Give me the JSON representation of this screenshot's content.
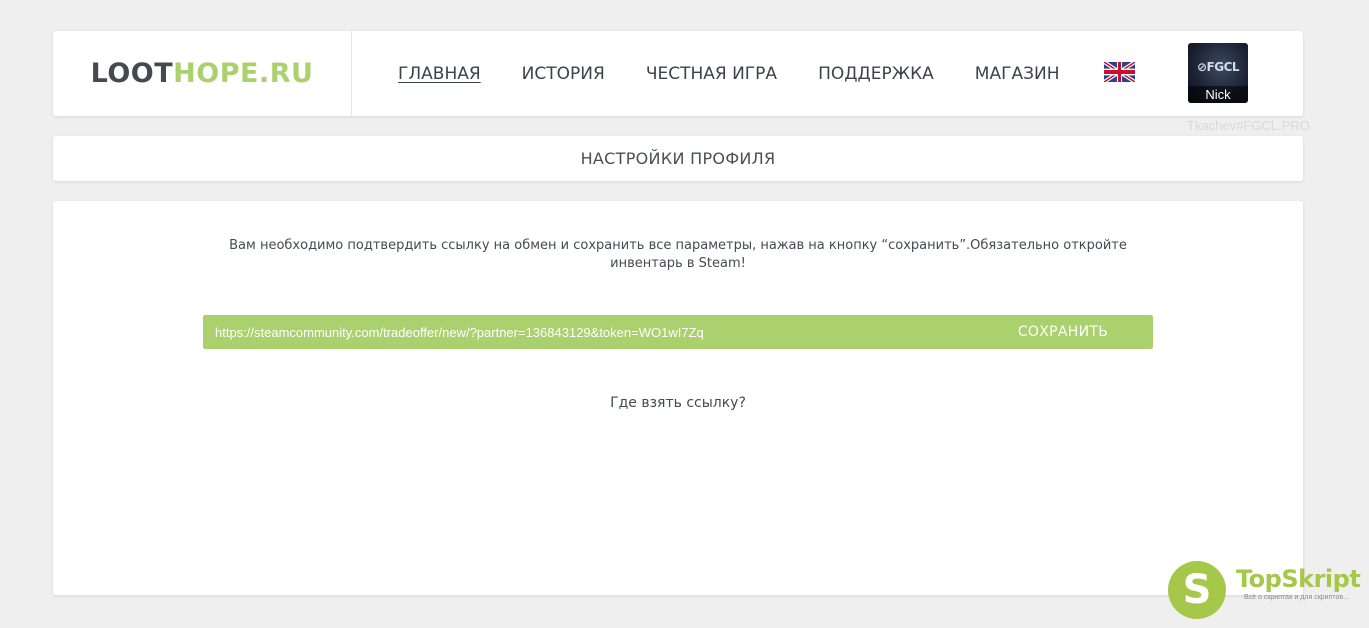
{
  "header": {
    "logo_part1": "LOOT",
    "logo_part2": "HOPE.RU",
    "nav": [
      {
        "label": "ГЛАВНАЯ",
        "active": true
      },
      {
        "label": "ИСТОРИЯ",
        "active": false
      },
      {
        "label": "ЧЕСТНАЯ ИГРА",
        "active": false
      },
      {
        "label": "ПОДДЕРЖКА",
        "active": false
      },
      {
        "label": "МАГАЗИН",
        "active": false
      }
    ],
    "language_icon": "uk-flag-icon",
    "avatar_logo": "⊘FGCL",
    "avatar_label": "Nick",
    "username": "Tkachev#FGCL.PRO"
  },
  "page_title": "НАСТРОЙКИ ПРОФИЛЯ",
  "main": {
    "instructions": "Вам необходимо подтвердить ссылку на обмен и сохранить все параметры, нажав на кнопку “сохранить”.Обязательно откройте инвентарь в Steam!",
    "trade_url_value": "https://steamcommunity.com/tradeoffer/new/?partner=136843129&token=WO1wI7Zq",
    "save_label": "СОХРАНИТЬ",
    "help_link": "Где взять ссылку?"
  },
  "watermark": {
    "letter": "S",
    "title": "TopSkript",
    "subtitle": "Всё о скриптах и для скриптов..."
  },
  "colors": {
    "accent": "#abd06e",
    "background": "#efefef",
    "text": "#3a3f47"
  }
}
